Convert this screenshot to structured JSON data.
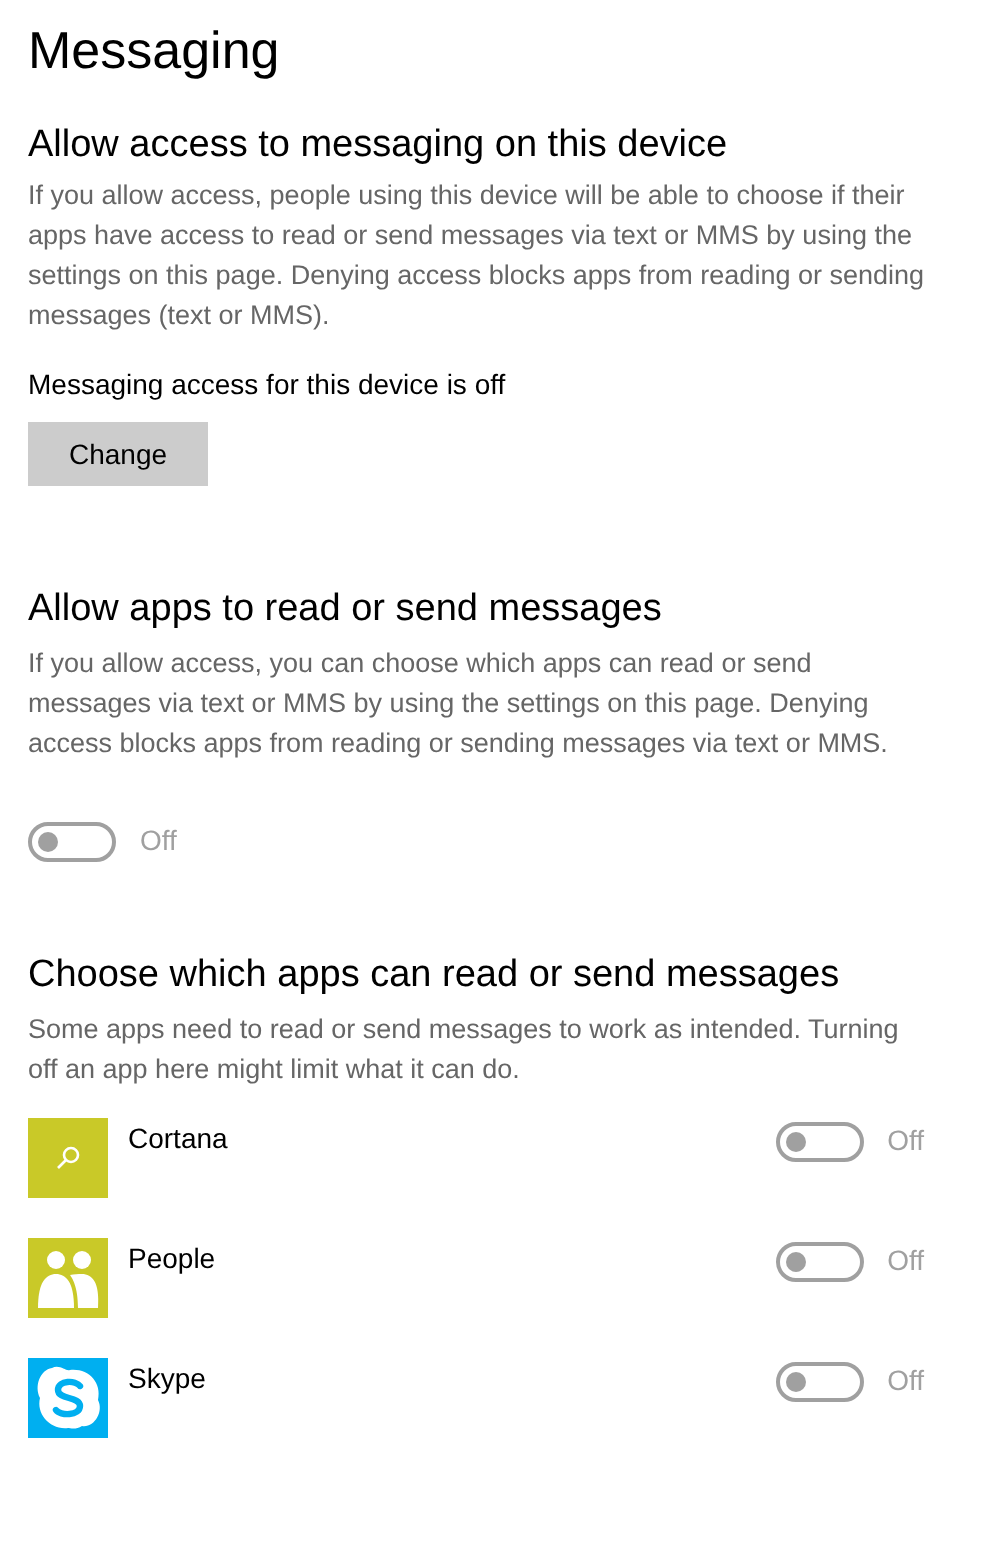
{
  "title": "Messaging",
  "access_section": {
    "heading": "Allow access to messaging on this device",
    "description": "If you allow access, people using this device will be able to choose if their apps have access to read or send messages via text or MMS by using the settings on this page. Denying access blocks apps from reading or sending messages (text or MMS).",
    "status": "Messaging access for this device is off",
    "button": "Change"
  },
  "apps_section": {
    "heading": "Allow apps to read or send messages",
    "description": "If you allow access, you can choose which apps can read or send messages via text or MMS by using the settings on this page. Denying access blocks apps from reading or sending messages via text or MMS.",
    "toggle": {
      "on": false,
      "disabled": true,
      "label": "Off"
    }
  },
  "choose_section": {
    "heading": "Choose which apps can read or send messages",
    "description": "Some apps need to read or send messages to work as intended. Turning off an app here might limit what it can do.",
    "apps": [
      {
        "name": "Cortana",
        "kind": "search",
        "color": "#c9c928",
        "toggle": {
          "on": false,
          "disabled": true,
          "label": "Off"
        }
      },
      {
        "name": "People",
        "kind": "people",
        "color": "#c9c928",
        "toggle": {
          "on": false,
          "disabled": true,
          "label": "Off"
        }
      },
      {
        "name": "Skype",
        "kind": "chat",
        "color": "#00aff0",
        "toggle": {
          "on": false,
          "disabled": true,
          "label": "Off"
        }
      }
    ]
  }
}
